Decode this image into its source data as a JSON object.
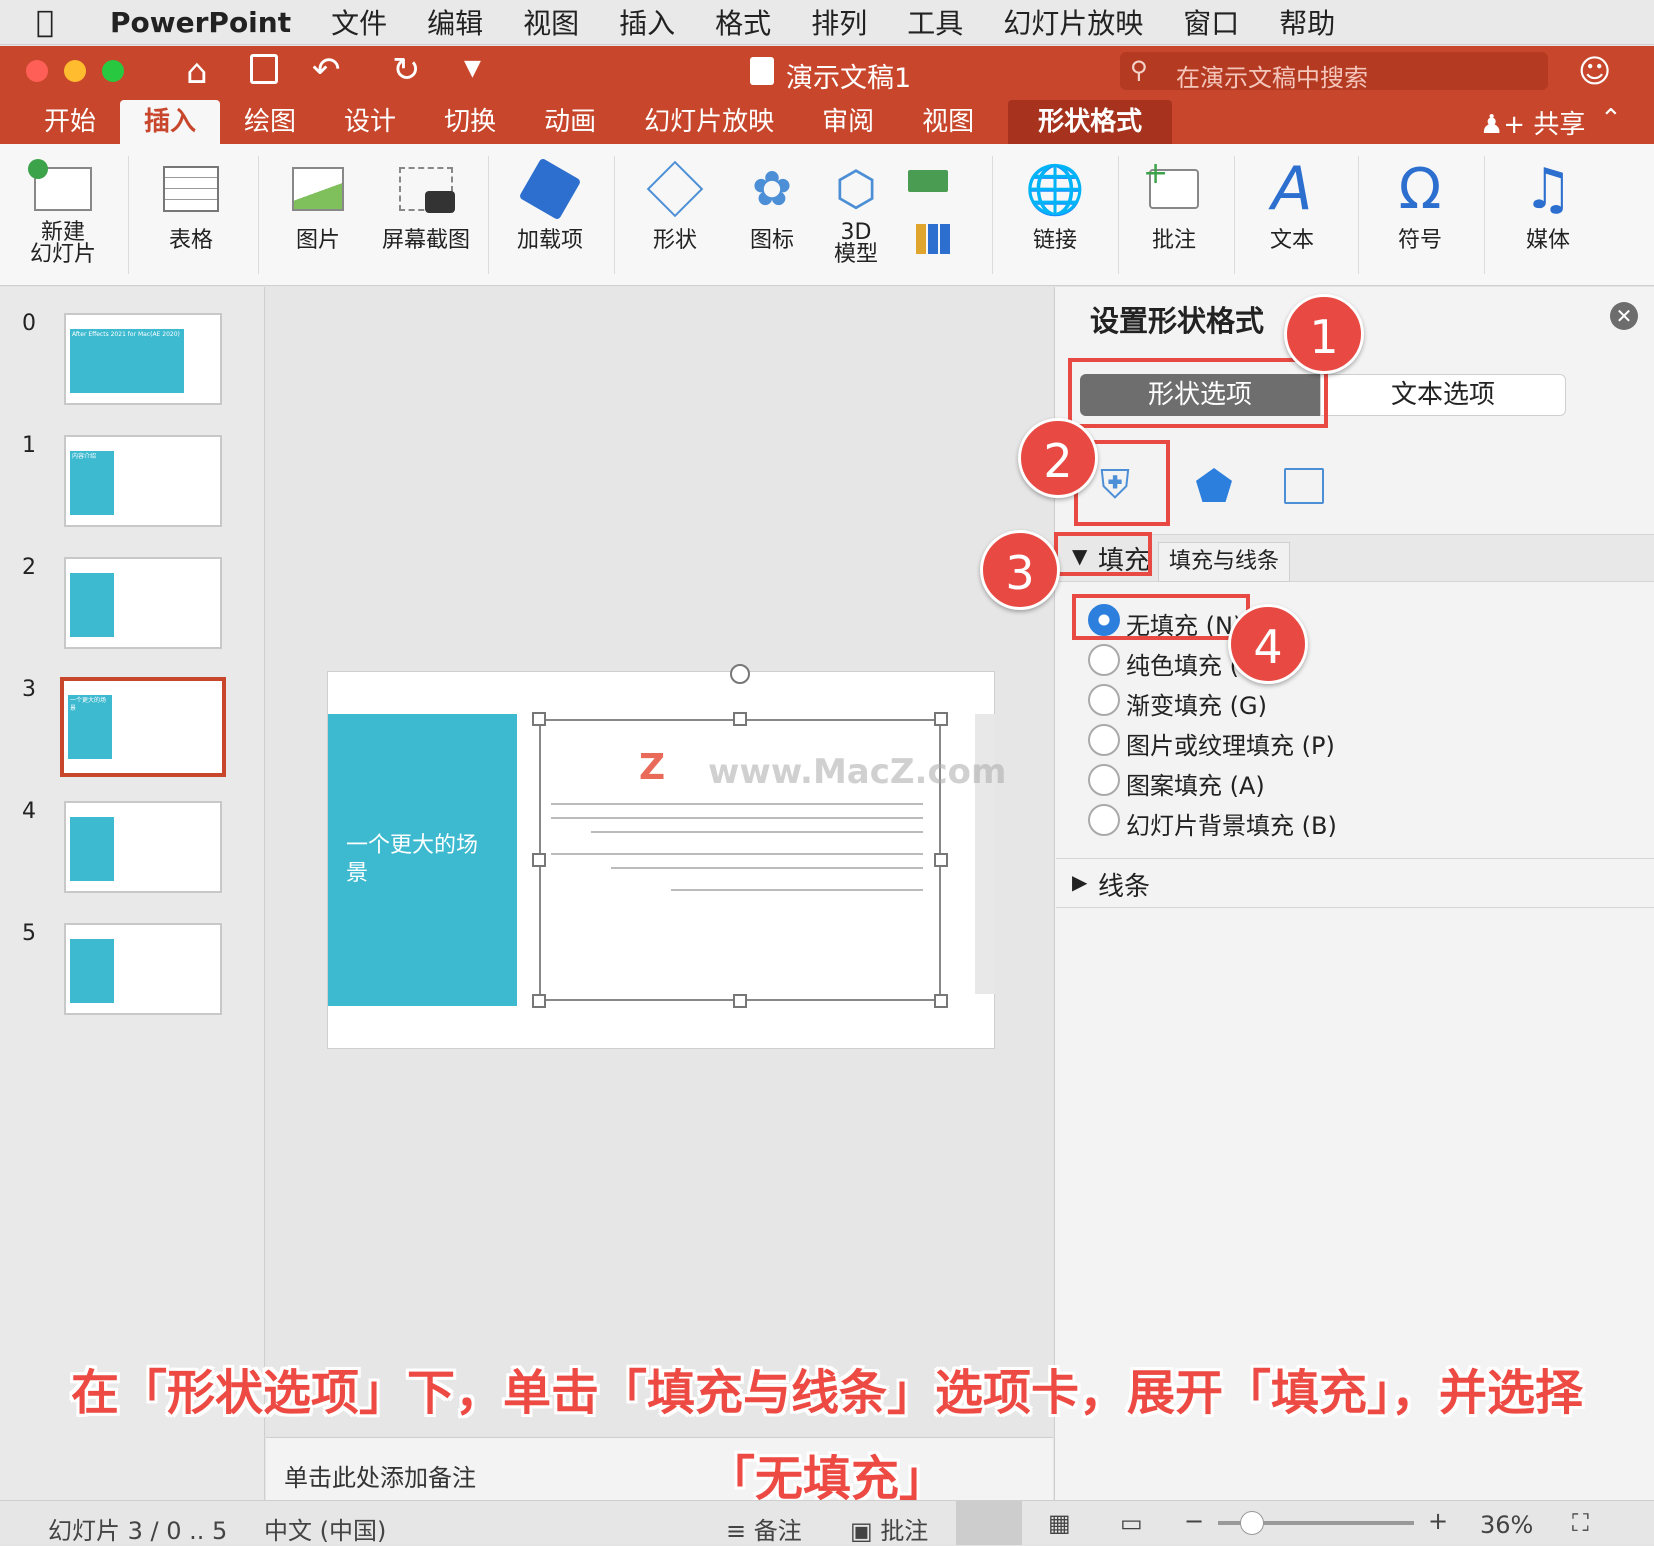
{
  "menubar": {
    "app": "PowerPoint",
    "items": [
      "文件",
      "编辑",
      "视图",
      "插入",
      "格式",
      "排列",
      "工具",
      "幻灯片放映",
      "窗口",
      "帮助"
    ]
  },
  "titlebar": {
    "doc_title": "演示文稿1",
    "search_placeholder": "在演示文稿中搜索"
  },
  "ribbon_tabs": [
    "开始",
    "插入",
    "绘图",
    "设计",
    "切换",
    "动画",
    "幻灯片放映",
    "审阅",
    "视图",
    "形状格式"
  ],
  "share_label": "共享",
  "ribbon": {
    "new_slide": "新建\n幻灯片",
    "table": "表格",
    "picture": "图片",
    "screenshot": "屏幕截图",
    "addins": "加载项",
    "shapes": "形状",
    "icons": "图标",
    "model3d": "3D\n模型",
    "link": "链接",
    "comment": "批注",
    "text": "文本",
    "symbol": "符号",
    "media": "媒体"
  },
  "thumbnails": [
    {
      "num": "0",
      "text": "After Effects 2021 for Mac(AE 2020)"
    },
    {
      "num": "1",
      "text": "内容介绍"
    },
    {
      "num": "2",
      "text": ""
    },
    {
      "num": "3",
      "text": "一个更大的场景"
    },
    {
      "num": "4",
      "text": ""
    },
    {
      "num": "5",
      "text": ""
    }
  ],
  "slide": {
    "title": "一个更大的场景",
    "watermark": "www.MacZ.com",
    "watermark_letter": "Z"
  },
  "panel": {
    "title": "设置形状格式",
    "shape_options": "形状选项",
    "text_options": "文本选项",
    "fill_header": "填充",
    "tooltip": "填充与线条",
    "fill_options": [
      "无填充 (N)",
      "纯色填充 (",
      "渐变填充 (G)",
      "图片或纹理填充 (P)",
      "图案填充 (A)",
      "幻灯片背景填充 (B)"
    ],
    "line_header": "线条"
  },
  "badges": [
    "1",
    "2",
    "3",
    "4"
  ],
  "caption_line1": "在「形状选项」下，单击「填充与线条」选项卡，展开「填充」，并选择",
  "caption_line2": "「无填充」",
  "notes_placeholder": "单击此处添加备注",
  "status": {
    "slide_count": "幻灯片 3 / 0 .. 5",
    "language": "中文 (中国)",
    "notes": "备注",
    "comments": "批注",
    "zoom": "36%"
  },
  "colors": {
    "accent": "#c8472c",
    "teal": "#3ebad0",
    "annotation": "#e84a43"
  }
}
